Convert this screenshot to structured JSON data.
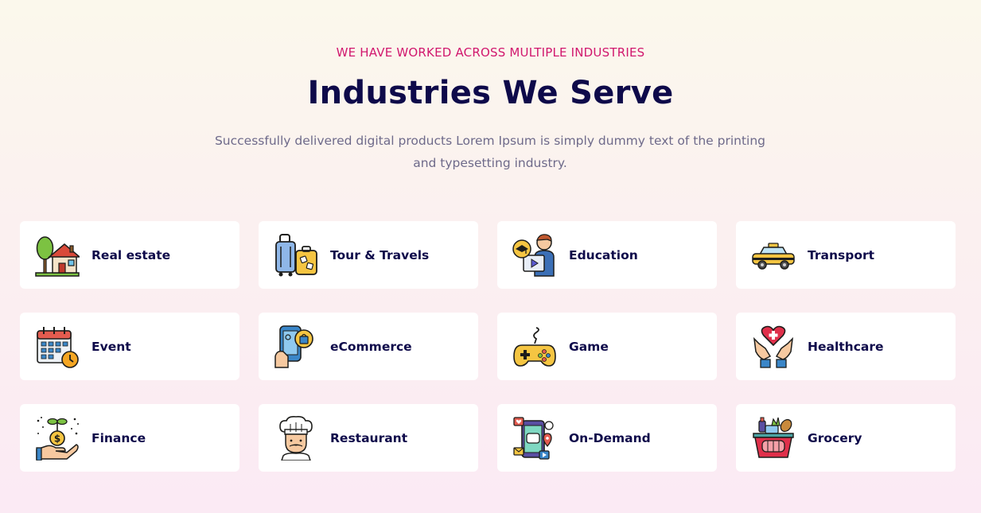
{
  "header": {
    "eyebrow": "WE HAVE WORKED ACROSS MULTIPLE INDUSTRIES",
    "title": "Industries We Serve",
    "subtitle": "Successfully delivered digital products Lorem Ipsum is simply dummy text of the printing and typesetting industry."
  },
  "industries": [
    {
      "label": "Real estate",
      "icon": "house-icon"
    },
    {
      "label": "Tour & Travels",
      "icon": "luggage-icon"
    },
    {
      "label": "Education",
      "icon": "teacher-icon"
    },
    {
      "label": "Transport",
      "icon": "taxi-icon"
    },
    {
      "label": "Event",
      "icon": "calendar-icon"
    },
    {
      "label": "eCommerce",
      "icon": "mobile-shopping-icon"
    },
    {
      "label": "Game",
      "icon": "gamepad-icon"
    },
    {
      "label": "Healthcare",
      "icon": "heart-hands-icon"
    },
    {
      "label": "Finance",
      "icon": "money-plant-hand-icon"
    },
    {
      "label": "Restaurant",
      "icon": "chef-icon"
    },
    {
      "label": "On-Demand",
      "icon": "on-demand-app-icon"
    },
    {
      "label": "Grocery",
      "icon": "grocery-basket-icon"
    }
  ],
  "colors": {
    "accent": "#d1176e",
    "heading": "#0e0a4a",
    "body_text": "#6e6a8a",
    "card_bg": "#ffffff"
  }
}
